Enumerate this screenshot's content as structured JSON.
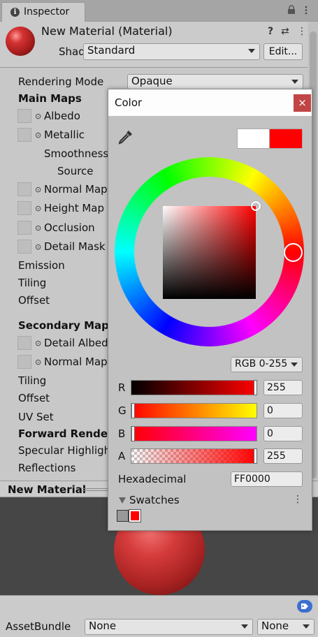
{
  "tab": {
    "label": "Inspector",
    "info_icon": "info-icon",
    "lock_icon": "lock-icon",
    "menu_icon": "kebab-menu-icon"
  },
  "header": {
    "title": "New Material (Material)",
    "shader_label": "Shader",
    "shader_value": "Standard",
    "edit_label": "Edit...",
    "help_icon": "?",
    "settings_icon": "⇄",
    "menu_icon": "⋮"
  },
  "properties": {
    "rendering_mode_label": "Rendering Mode",
    "rendering_mode_value": "Opaque",
    "main_maps": "Main Maps",
    "albedo": "Albedo",
    "metallic": "Metallic",
    "smoothness": "Smoothness",
    "source": "Source",
    "normal_map": "Normal Map",
    "height_map": "Height Map",
    "occlusion": "Occlusion",
    "detail_mask": "Detail Mask",
    "emission": "Emission",
    "tiling": "Tiling",
    "offset": "Offset",
    "secondary_maps": "Secondary Maps",
    "detail_albedo": "Detail Albedo",
    "normal_map_2": "Normal Map",
    "tiling_2": "Tiling",
    "offset_2": "Offset",
    "uv_set": "UV Set",
    "forward_rendering": "Forward Rendering",
    "specular_highlights": "Specular Highlights",
    "reflections": "Reflections"
  },
  "preview": {
    "title": "New Material"
  },
  "asset_bundle": {
    "label": "AssetBundle",
    "value1": "None",
    "value2": "None"
  },
  "color_picker": {
    "title": "Color",
    "close": "×",
    "new_color": "#ffffff",
    "current_color": "#ff0000",
    "mode": "RGB 0-255",
    "channels": {
      "r_label": "R",
      "r_value": "255",
      "g_label": "G",
      "g_value": "0",
      "b_label": "B",
      "b_value": "0",
      "a_label": "A",
      "a_value": "255"
    },
    "hex_label": "Hexadecimal",
    "hex_value": "FF0000",
    "swatches_label": "Swatches",
    "swatches_menu": "⋮",
    "swatch_colors": [
      "#999999",
      "#ff0000"
    ]
  },
  "colors": {
    "accent": "#3d6fd0",
    "close_button": "#c14545",
    "panel": "#c8c8c8"
  }
}
